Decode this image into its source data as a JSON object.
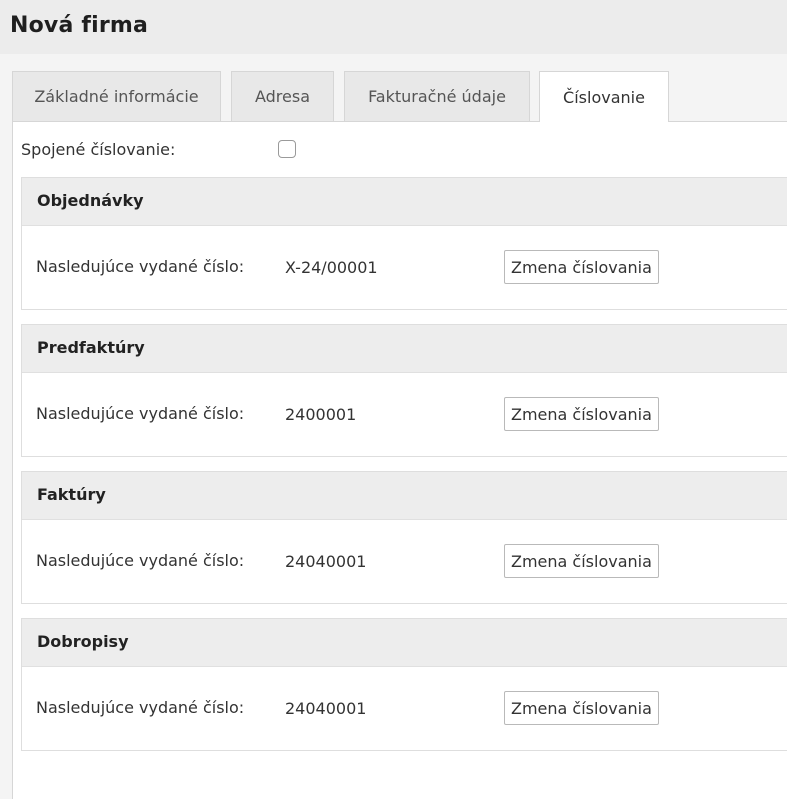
{
  "header": {
    "title": "Nová firma"
  },
  "tabs": [
    {
      "label": "Základné informácie",
      "active": false
    },
    {
      "label": "Adresa",
      "active": false
    },
    {
      "label": "Fakturačné údaje",
      "active": false
    },
    {
      "label": "Číslovanie",
      "active": true
    }
  ],
  "joint_numbering": {
    "label": "Spojené číslovanie:",
    "checked": false
  },
  "sections": [
    {
      "title": "Objednávky",
      "next_number_label": "Nasledujúce vydané číslo:",
      "next_number_value": "X-24/00001",
      "change_button_label": "Zmena číslovania"
    },
    {
      "title": "Predfaktúry",
      "next_number_label": "Nasledujúce vydané číslo:",
      "next_number_value": "2400001",
      "change_button_label": "Zmena číslovania"
    },
    {
      "title": "Faktúry",
      "next_number_label": "Nasledujúce vydané číslo:",
      "next_number_value": "24040001",
      "change_button_label": "Zmena číslovania"
    },
    {
      "title": "Dobropisy",
      "next_number_label": "Nasledujúce vydané číslo:",
      "next_number_value": "24040001",
      "change_button_label": "Zmena číslovania"
    }
  ]
}
